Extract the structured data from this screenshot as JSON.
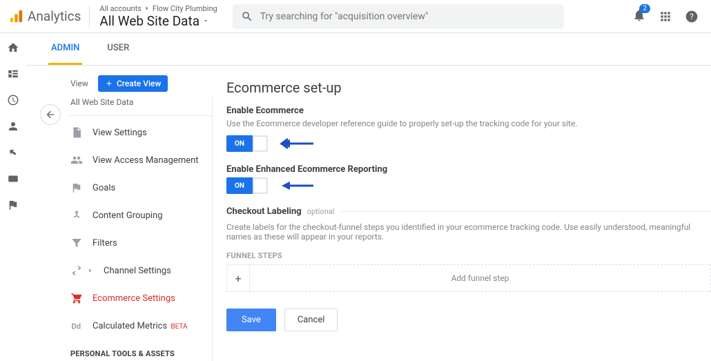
{
  "header": {
    "product": "Analytics",
    "breadcrumb_1": "All accounts",
    "breadcrumb_2": "Flow City Plumbing",
    "view_name": "All Web Site Data",
    "search_placeholder": "Try searching for \"acquisition overview\"",
    "notif_count": "2"
  },
  "tabs": {
    "admin": "ADMIN",
    "user": "USER"
  },
  "sidebar": {
    "view_label": "View",
    "create_btn": "Create View",
    "view_sub": "All Web Site Data",
    "items": [
      {
        "label": "View Settings"
      },
      {
        "label": "View Access Management"
      },
      {
        "label": "Goals"
      },
      {
        "label": "Content Grouping"
      },
      {
        "label": "Filters"
      },
      {
        "label": "Channel Settings"
      },
      {
        "label": "Ecommerce Settings"
      },
      {
        "label": "Calculated Metrics"
      }
    ],
    "beta": "BETA",
    "section": "PERSONAL TOOLS & ASSETS"
  },
  "page": {
    "title": "Ecommerce set-up",
    "enable_title": "Enable Ecommerce",
    "enable_desc": "Use the Ecommerce developer reference guide to properly set-up the tracking code for your site.",
    "toggle_on": "ON",
    "enhanced_title": "Enable Enhanced Ecommerce Reporting",
    "checkout_title": "Checkout Labeling",
    "optional": "optional",
    "checkout_desc": "Create labels for the checkout-funnel steps you identified in your ecommerce tracking code. Use easily understood, meaningful names as these will appear in your reports.",
    "funnel_label": "FUNNEL STEPS",
    "funnel_add": "+",
    "funnel_placeholder": "Add funnel step",
    "save": "Save",
    "cancel": "Cancel"
  }
}
